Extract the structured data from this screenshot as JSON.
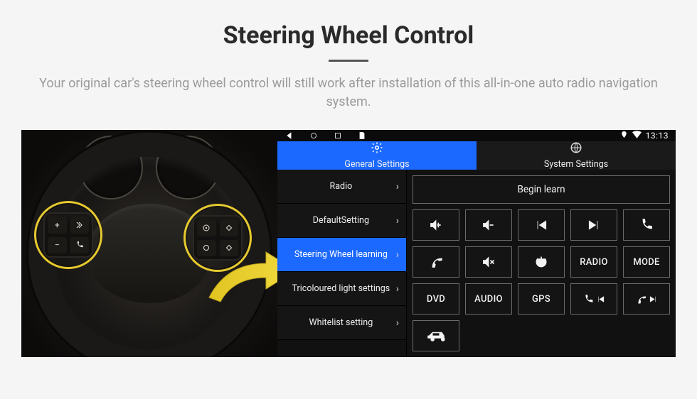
{
  "title": "Steering Wheel Control",
  "subtitle": "Your original car's steering wheel control will still work after installation of this all-in-one auto radio navigation system.",
  "statusbar": {
    "clock": "13:13"
  },
  "tabs": {
    "general": "General Settings",
    "system": "System Settings"
  },
  "settings_list": [
    {
      "label": "Radio",
      "selected": false
    },
    {
      "label": "DefaultSetting",
      "selected": false
    },
    {
      "label": "Steering Wheel learning",
      "selected": true
    },
    {
      "label": "Tricoloured light settings",
      "selected": false
    },
    {
      "label": "Whitelist setting",
      "selected": false
    }
  ],
  "learn_button": "Begin learn",
  "fn_text": {
    "radio": "RADIO",
    "mode": "MODE",
    "dvd": "DVD",
    "audio": "AUDIO",
    "gps": "GPS"
  }
}
